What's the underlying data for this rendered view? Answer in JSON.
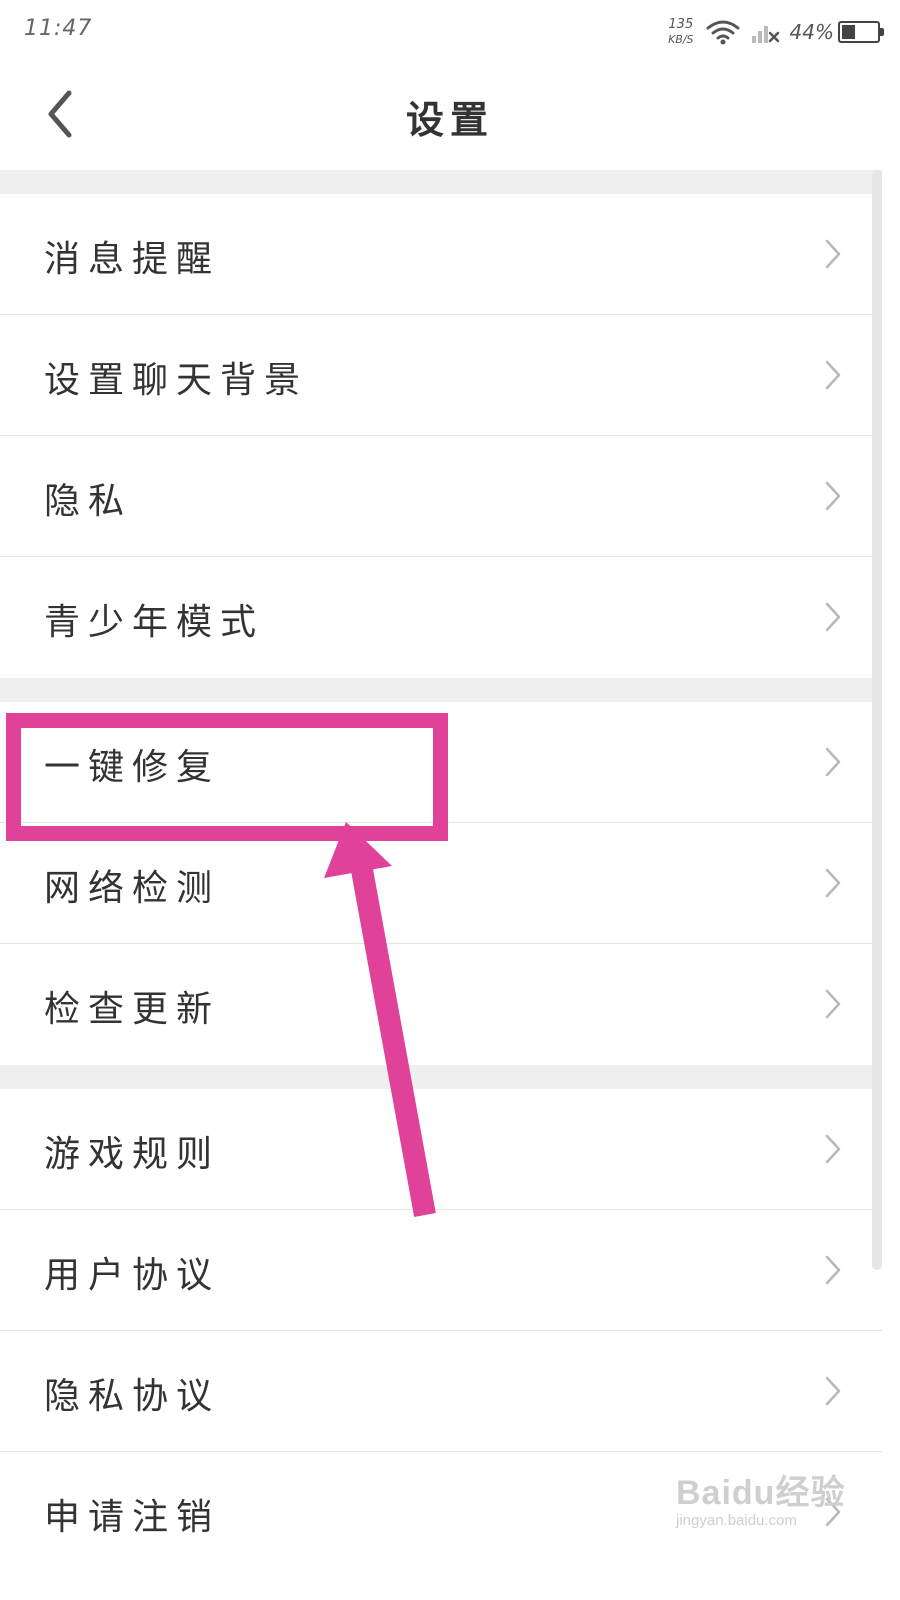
{
  "status_bar": {
    "time": "11:47",
    "net_speed_value": "135",
    "net_speed_unit": "KB/S",
    "battery_percent": "44%",
    "battery_level": 0.44,
    "wifi_icon": "wifi-icon",
    "signal_icon": "signal-off-icon"
  },
  "header": {
    "title": "设置",
    "back_icon": "chevron-left-icon"
  },
  "settings": {
    "group1": [
      {
        "label": "消息提醒"
      },
      {
        "label": "设置聊天背景"
      },
      {
        "label": "隐私"
      },
      {
        "label": "青少年模式"
      }
    ],
    "group2": [
      {
        "label": "一键修复"
      },
      {
        "label": "网络检测"
      },
      {
        "label": "检查更新"
      }
    ],
    "group3": [
      {
        "label": "游戏规则"
      },
      {
        "label": "用户协议"
      },
      {
        "label": "隐私协议"
      },
      {
        "label": "申请注销"
      }
    ]
  },
  "annotation": {
    "highlight_color": "#e0429a"
  },
  "watermark": {
    "main": "Baidu经验",
    "sub": "jingyan.baidu.com"
  }
}
